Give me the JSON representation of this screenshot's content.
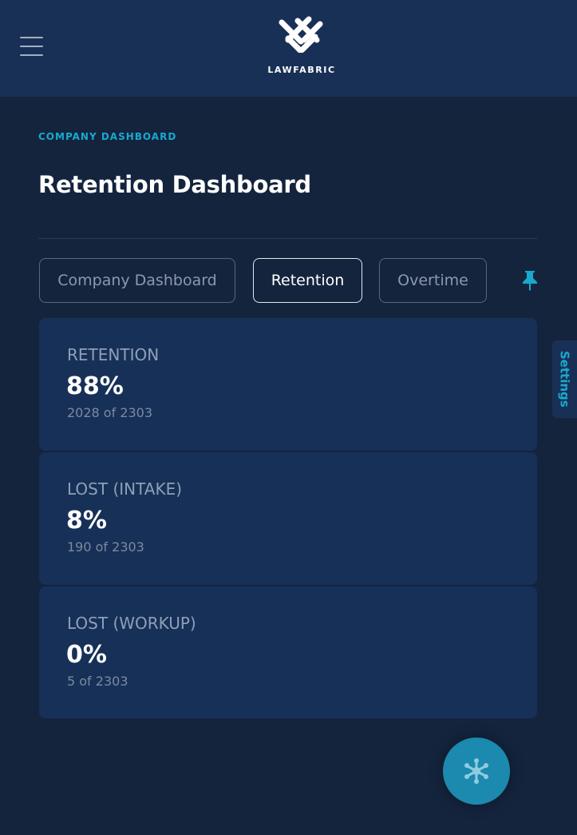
{
  "header": {
    "brand": "LAWFABRIC",
    "icons": {
      "menu": "hamburger-menu-icon",
      "logo": "lawfabric-logo-icon"
    }
  },
  "page": {
    "eyebrow": "COMPANY DASHBOARD",
    "title": "Retention Dashboard"
  },
  "tabs": [
    {
      "label": "Company Dashboard",
      "active": false
    },
    {
      "label": "Retention",
      "active": true
    },
    {
      "label": "Overtime",
      "active": false
    }
  ],
  "pin_icon": "pin-icon",
  "settings": {
    "label": "Settings"
  },
  "cards": [
    {
      "label": "RETENTION",
      "value": "88%",
      "detail": "2028 of 2303"
    },
    {
      "label": "LOST (INTAKE)",
      "value": "8%",
      "detail": "190 of 2303"
    },
    {
      "label": "LOST (WORKUP)",
      "value": "0%",
      "detail": "5 of 2303"
    }
  ],
  "fab_icon": "network-icon",
  "colors": {
    "background": "#14243d",
    "header": "#193056",
    "card": "#173057",
    "accent": "#19a9cf",
    "fab": "#1b8aae"
  }
}
